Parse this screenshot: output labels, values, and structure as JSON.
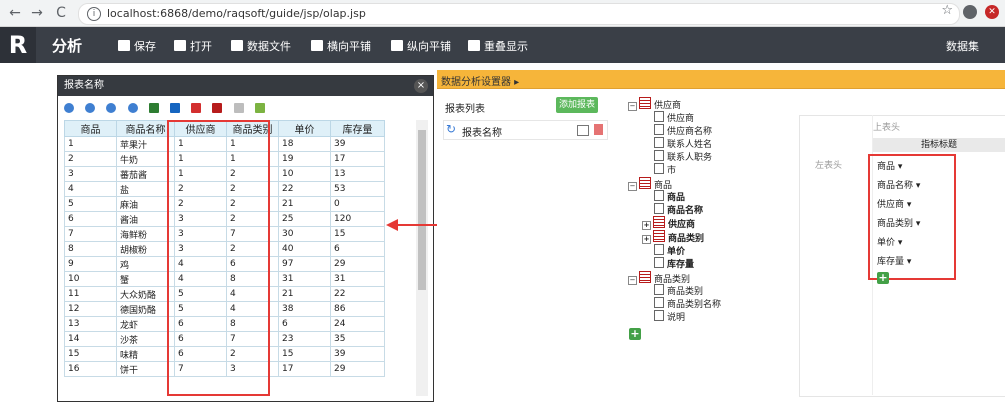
{
  "browser": {
    "url": "localhost:6868/demo/raqsoft/guide/jsp/olap.jsp",
    "info_glyph": "i",
    "back_glyph": "←",
    "forward_glyph": "→",
    "reload_glyph": "C",
    "star_glyph": "☆",
    "ext_glyph": "✕"
  },
  "app": {
    "logo": "R",
    "title": "分析",
    "toolbar": [
      {
        "label": "保存",
        "icon": "save-icon"
      },
      {
        "label": "打开",
        "icon": "folder-open-icon"
      },
      {
        "label": "数据文件",
        "icon": "data-file-icon"
      },
      {
        "label": "横向平铺",
        "icon": "tile-horizontal-icon"
      },
      {
        "label": "纵向平铺",
        "icon": "tile-vertical-icon"
      },
      {
        "label": "重叠显示",
        "icon": "overlap-icon"
      }
    ],
    "dataset_label": "数据集"
  },
  "popup": {
    "title": "报表名称",
    "close_glyph": "×",
    "columns": [
      "商品",
      "商品名称",
      "供应商",
      "商品类别",
      "单价",
      "库存量"
    ],
    "rows": [
      [
        "1",
        "苹果汁",
        "1",
        "1",
        "18",
        "39"
      ],
      [
        "2",
        "牛奶",
        "1",
        "1",
        "19",
        "17"
      ],
      [
        "3",
        "蕃茄酱",
        "1",
        "2",
        "10",
        "13"
      ],
      [
        "4",
        "盐",
        "2",
        "2",
        "22",
        "53"
      ],
      [
        "5",
        "麻油",
        "2",
        "2",
        "21",
        "0"
      ],
      [
        "6",
        "酱油",
        "3",
        "2",
        "25",
        "120"
      ],
      [
        "7",
        "海鲜粉",
        "3",
        "7",
        "30",
        "15"
      ],
      [
        "8",
        "胡椒粉",
        "3",
        "2",
        "40",
        "6"
      ],
      [
        "9",
        "鸡",
        "4",
        "6",
        "97",
        "29"
      ],
      [
        "10",
        "蟹",
        "4",
        "8",
        "31",
        "31"
      ],
      [
        "11",
        "大众奶酪",
        "5",
        "4",
        "21",
        "22"
      ],
      [
        "12",
        "德国奶酪",
        "5",
        "4",
        "38",
        "86"
      ],
      [
        "13",
        "龙虾",
        "6",
        "8",
        "6",
        "24"
      ],
      [
        "14",
        "沙茶",
        "6",
        "7",
        "23",
        "35"
      ],
      [
        "15",
        "味精",
        "6",
        "2",
        "15",
        "39"
      ],
      [
        "16",
        "饼干",
        "7",
        "3",
        "17",
        "29"
      ]
    ]
  },
  "settings": {
    "title": "数据分析设置器 ▸",
    "report_list_label": "报表列表",
    "add_report_label": "添加报表",
    "report_item_name": "报表名称",
    "refresh_glyph": "↻",
    "plus_glyph": "+",
    "tree": {
      "groups": [
        {
          "label": "供应商",
          "toggle": "−",
          "fields": [
            "供应商",
            "供应商名称",
            "联系人姓名",
            "联系人职务",
            "市"
          ]
        },
        {
          "label": "商品",
          "toggle": "−",
          "fields": [
            "商品",
            "商品名称",
            "供应商",
            "商品类别",
            "单价",
            "库存量"
          ]
        },
        {
          "label": "商品类别",
          "toggle": "−",
          "fields": [
            "商品类别",
            "商品类别名称",
            "说明"
          ]
        }
      ],
      "expand_glyph": "+"
    },
    "designer": {
      "top_header": "上表头",
      "indicator_title": "指标标题",
      "left_header": "左表头",
      "dimensions": [
        "商品 ▾",
        "商品名称 ▾",
        "供应商 ▾",
        "商品类别 ▾",
        "单价 ▾",
        "库存量 ▾"
      ]
    }
  },
  "colors": {
    "appbar": "#3a3f47",
    "orange": "#f6b53a",
    "highlight": "#e53935",
    "green": "#5cb85c"
  }
}
